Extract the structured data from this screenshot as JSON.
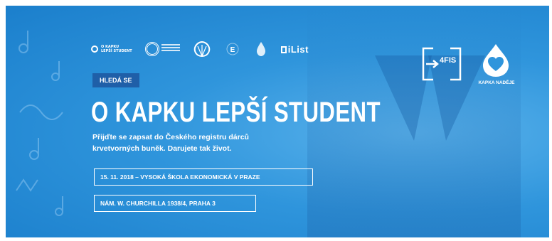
{
  "partners": {
    "kapka_small_line1": "O KAPKU",
    "kapka_small_line2": "LEPŠÍ STUDENT",
    "ilist": "iList"
  },
  "tag": "HLEDÁ SE",
  "headline": "O KAPKU LEPŠÍ STUDENT",
  "lead_line1": "Přijďte se zapsat do Českého registru dárců",
  "lead_line2": "krvetvorných buněk. Darujete tak život.",
  "event_date_place": "15. 11. 2018 – VYSOKÁ ŠKOLA EKONOMICKÁ V PRAZE",
  "event_address": "NÁM. W. CHURCHILLA 1938/4, PRAHA 3",
  "fis_logo": "4FIS",
  "kapka_logo": "KAPKA NADĚJE",
  "colors": {
    "background": "#2f95dc",
    "tag_bg": "#1f5fa8",
    "text": "#ffffff"
  }
}
